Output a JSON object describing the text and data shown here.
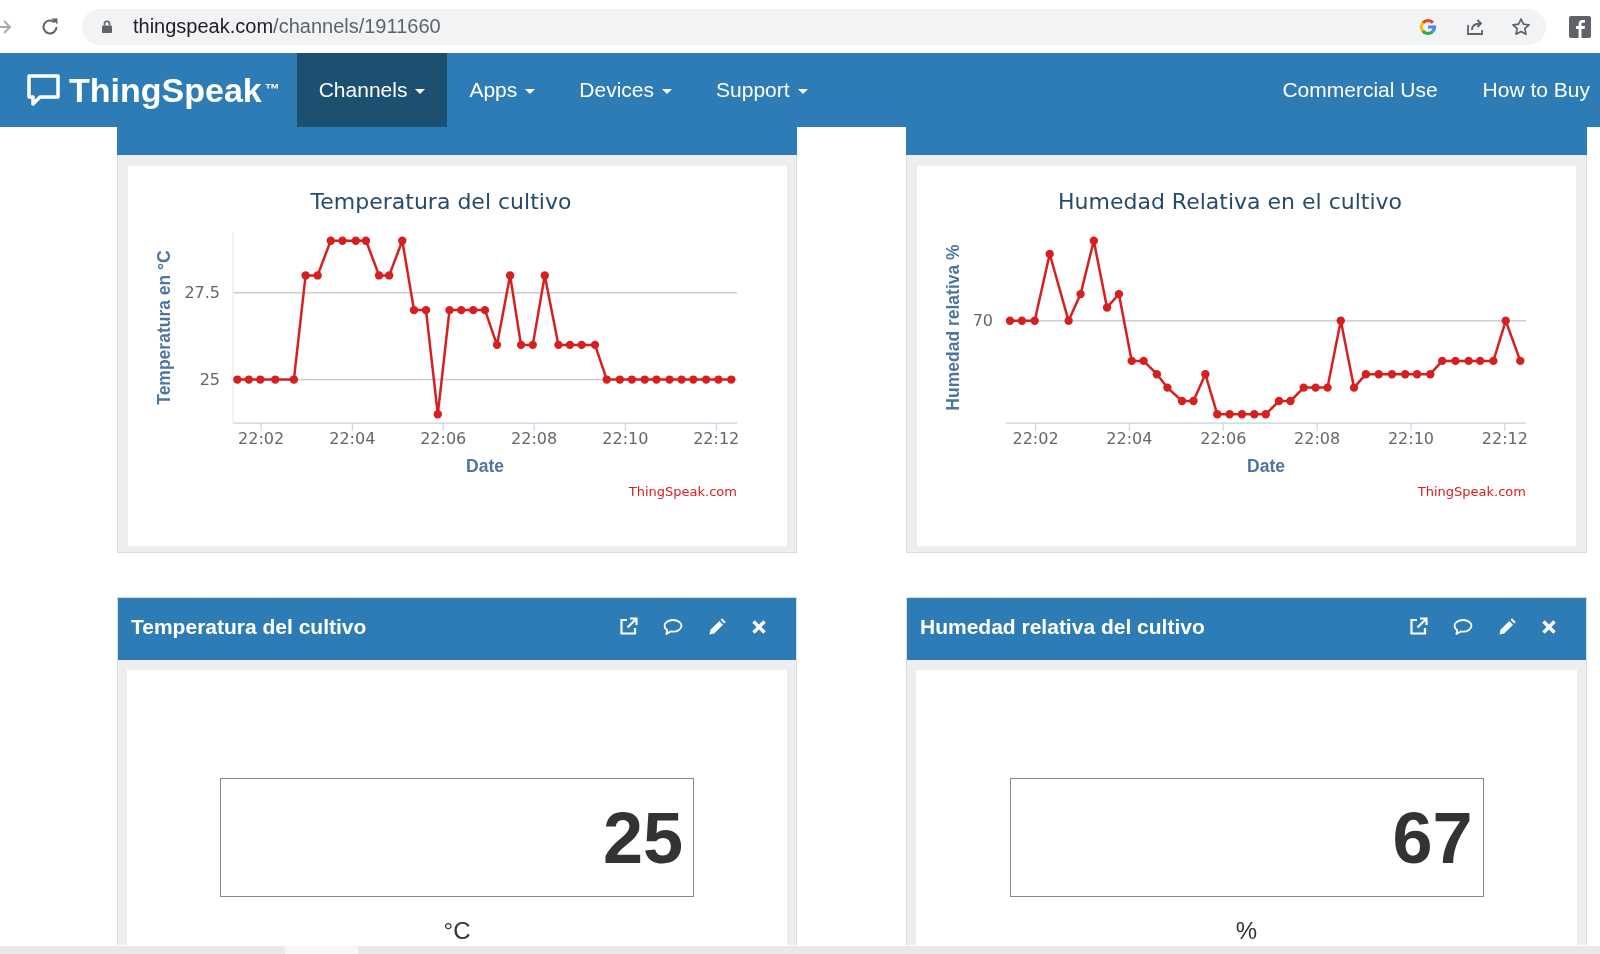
{
  "browser": {
    "url": {
      "host": "thingspeak.com",
      "path": "/channels/1911660"
    }
  },
  "nav": {
    "logo": "ThingSpeak$^{™}$",
    "items": [
      {
        "label": "Channels",
        "dropdown": true,
        "selected": true
      },
      {
        "label": "Apps",
        "dropdown": true,
        "selected": false
      },
      {
        "label": "Devices",
        "dropdown": true,
        "selected": false
      },
      {
        "label": "Support",
        "dropdown": true,
        "selected": false
      }
    ],
    "links": [
      {
        "label": "Commercial Use",
        "selected": false
      },
      {
        "label": "How to Buy",
        "selected": false
      }
    ]
  },
  "chart_widgets": [
    {
      "kind": "chart",
      "chart_data": {
        "type": "line",
        "title": "Temperatura del cultivo",
        "xlabel": "Date",
        "ylabel": "Temperatura en °C",
        "x": [
          22.0246,
          22.0288,
          22.033,
          22.0385,
          22.0453,
          22.0496,
          22.054,
          22.0588,
          22.0631,
          22.068,
          22.0717,
          22.0765,
          22.0802,
          22.085,
          22.0893,
          22.0937,
          22.098,
          22.1023,
          22.1066,
          22.111,
          22.1153,
          22.1197,
          22.1245,
          22.1285,
          22.1328,
          22.1372,
          22.1422,
          22.1464,
          22.1507,
          22.1556,
          22.1599,
          22.1647,
          22.1691,
          22.1738,
          22.1781,
          22.1829,
          22.1873,
          22.1916,
          22.1963,
          22.2008,
          22.2055
        ],
        "values": [
          25,
          25,
          25,
          25,
          25,
          28,
          28,
          29,
          29,
          29,
          29,
          28,
          28,
          29,
          27,
          27,
          24,
          27,
          27,
          27,
          27,
          26,
          28,
          26,
          26,
          28,
          26,
          26,
          26,
          26,
          25,
          25,
          25,
          25,
          25,
          25,
          25,
          25,
          25,
          25,
          25
        ],
        "color": "#d62020",
        "xlim": [
          22.023,
          22.2076
        ],
        "xticks": [
          {
            "value": 22.0333,
            "label": "22:02"
          },
          {
            "value": 22.0667,
            "label": "22:04"
          },
          {
            "value": 22.1,
            "label": "22:06"
          },
          {
            "value": 22.1333,
            "label": "22:08"
          },
          {
            "value": 22.1667,
            "label": "22:10"
          },
          {
            "value": 22.2,
            "label": "22:12"
          }
        ],
        "ylim": [
          23.75,
          29.25
        ],
        "yticks": [
          25,
          27.5
        ],
        "marker": "circle",
        "annotations": [
          "ThingSpeak.com"
        ]
      }
    },
    {
      "kind": "picture",
      "title": "Humedad Relativa en el cultivo",
      "y_axis_title": "Humedad relativa %",
      "y_tick_labels": [
        "70"
      ],
      "x_tick_labels": [
        "22:02",
        "22:04",
        "22:06",
        "22:08",
        "22:10",
        "22:12"
      ],
      "x_axis_title": "Date",
      "credit": "ThingSpeak.com"
    }
  ],
  "display_widgets": [
    {
      "title": "Temperatura del cultivo",
      "value": "25",
      "unit": "°C"
    },
    {
      "title": "Humedad relativa del cultivo",
      "value": "67",
      "unit": "%"
    }
  ]
}
